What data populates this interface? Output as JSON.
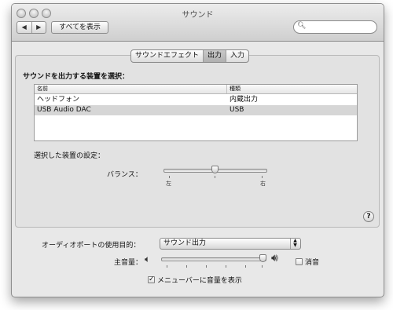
{
  "window": {
    "title": "サウンド"
  },
  "toolbar": {
    "back": "◀",
    "forward": "▶",
    "show_all": "すべてを表示",
    "search_placeholder": ""
  },
  "tabs": [
    {
      "label": "サウンドエフェクト",
      "selected": false
    },
    {
      "label": "出力",
      "selected": true
    },
    {
      "label": "入力",
      "selected": false
    }
  ],
  "output": {
    "heading": "サウンドを出力する装置を選択：",
    "columns": [
      "名前",
      "種類"
    ],
    "devices": [
      {
        "name": "ヘッドフォン",
        "type": "内蔵出力",
        "selected": false
      },
      {
        "name": "USB Audio DAC",
        "type": "USB",
        "selected": true
      }
    ],
    "settings_heading": "選択した装置の設定：",
    "balance": {
      "label": "バランス：",
      "left": "左",
      "right": "右",
      "value": 0.5
    }
  },
  "help": "?",
  "bottom": {
    "port_label": "オーディオポートの使用目的：",
    "port_value": "サウンド出力",
    "volume_label": "主音量：",
    "volume_value": 0.98,
    "mute_label": "消音",
    "mute_checked": false,
    "menubar_label": "メニューバーに音量を表示",
    "menubar_checked": true
  },
  "colors": {
    "selected_row": "#d6d6d6",
    "window_bg": "#e8e8e8"
  }
}
